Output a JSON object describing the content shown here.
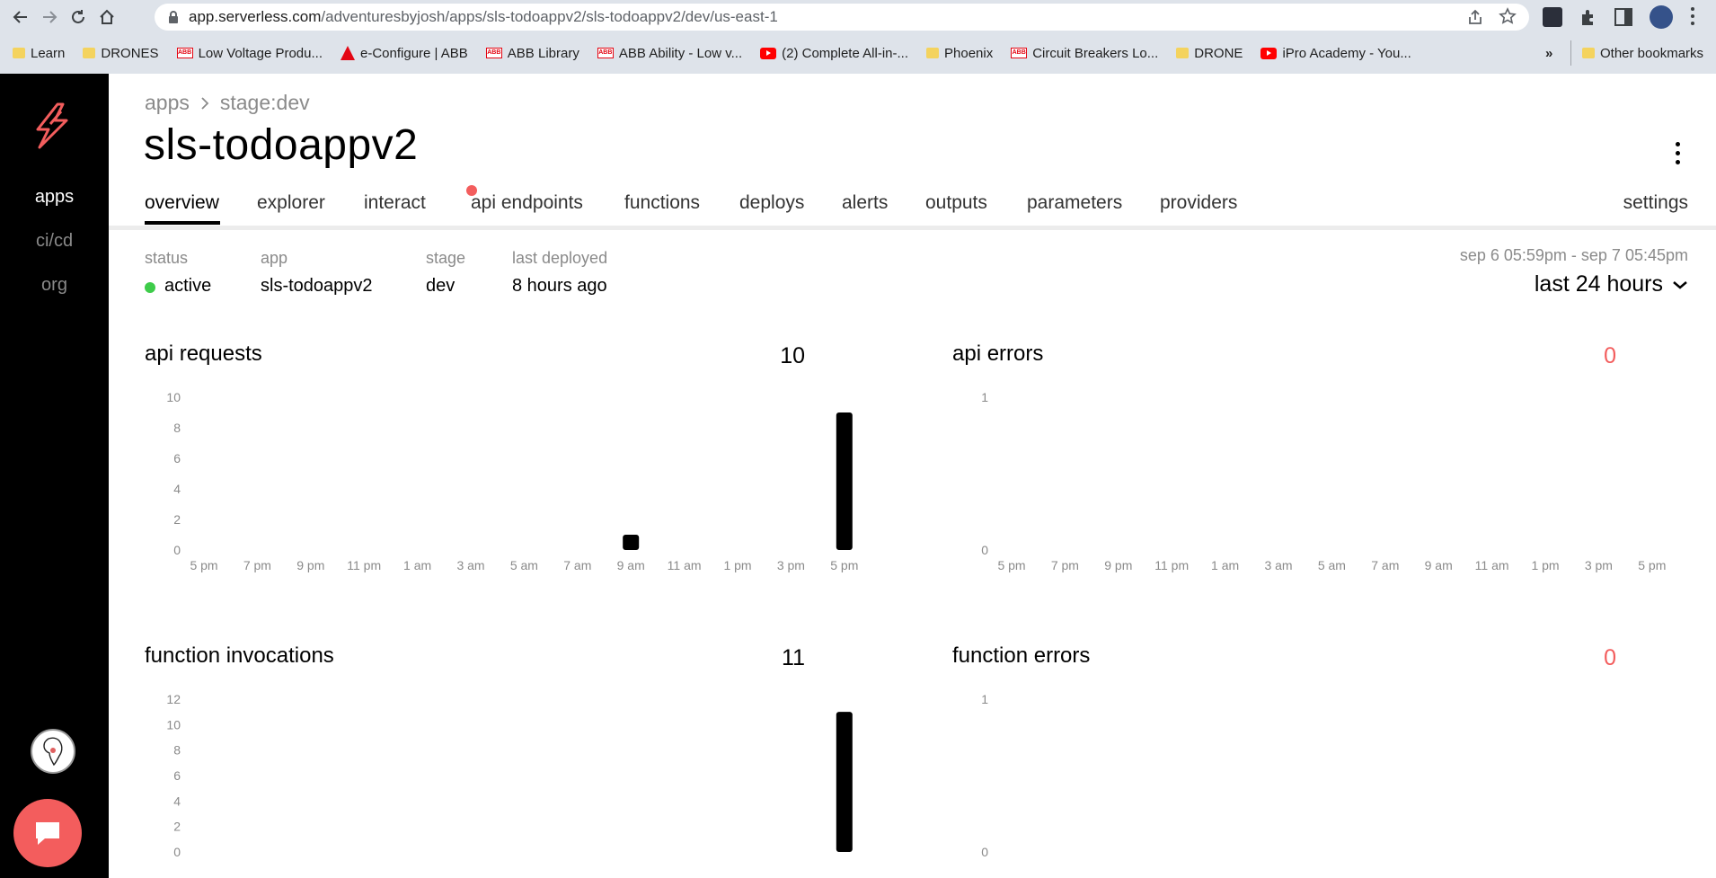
{
  "browser": {
    "url_host": "app.serverless.com",
    "url_path": "/adventuresbyjosh/apps/sls-todoappv2/sls-todoappv2/dev/us-east-1",
    "bookmarks": [
      {
        "label": "Learn",
        "icon": "folder-icon"
      },
      {
        "label": "DRONES",
        "icon": "folder-icon"
      },
      {
        "label": "Low Voltage Produ...",
        "icon": "abb-icon"
      },
      {
        "label": "e-Configure | ABB",
        "icon": "econfigure-icon"
      },
      {
        "label": "ABB Library",
        "icon": "abb-icon"
      },
      {
        "label": "ABB Ability - Low v...",
        "icon": "abb-icon"
      },
      {
        "label": "(2) Complete All-in-...",
        "icon": "youtube-icon"
      },
      {
        "label": "Phoenix",
        "icon": "folder-icon"
      },
      {
        "label": "Circuit Breakers Lo...",
        "icon": "abb-icon"
      },
      {
        "label": "DRONE",
        "icon": "folder-icon"
      },
      {
        "label": "iPro Academy - You...",
        "icon": "youtube-icon"
      }
    ],
    "more_bookmarks": "»",
    "other_bookmarks": "Other bookmarks"
  },
  "sidebar": {
    "items": [
      {
        "label": "apps",
        "active": true
      },
      {
        "label": "ci/cd",
        "active": false
      },
      {
        "label": "org",
        "active": false
      }
    ]
  },
  "breadcrumb": {
    "root": "apps",
    "current": "stage:dev"
  },
  "page_title": "sls-todoappv2",
  "tabs": [
    {
      "label": "overview",
      "active": true
    },
    {
      "label": "explorer"
    },
    {
      "label": "interact",
      "notification": true
    },
    {
      "label": "api endpoints"
    },
    {
      "label": "functions"
    },
    {
      "label": "deploys"
    },
    {
      "label": "alerts"
    },
    {
      "label": "outputs"
    },
    {
      "label": "parameters"
    },
    {
      "label": "providers"
    }
  ],
  "settings_tab": "settings",
  "meta": {
    "status_label": "status",
    "status_value": "active",
    "app_label": "app",
    "app_value": "sls-todoappv2",
    "stage_label": "stage",
    "stage_value": "dev",
    "deployed_label": "last deployed",
    "deployed_value": "8 hours ago"
  },
  "time_range": {
    "span": "sep 6 05:59pm - sep 7 05:45pm",
    "selected": "last 24 hours"
  },
  "colors": {
    "accent": "#f35d5d",
    "status_active": "#3ecc4a",
    "bar": "#000000"
  },
  "chart_data": [
    {
      "type": "bar",
      "title": "api requests",
      "total": "10",
      "x": [
        "5 pm",
        "7 pm",
        "9 pm",
        "11 pm",
        "1 am",
        "3 am",
        "5 am",
        "7 am",
        "9 am",
        "11 am",
        "1 pm",
        "3 pm",
        "5 pm"
      ],
      "yticks": [
        0,
        2,
        4,
        6,
        8,
        10
      ],
      "ylim": [
        0,
        10
      ],
      "bars": [
        {
          "x": "9 am",
          "value": 1
        },
        {
          "x": "5 pm",
          "value": 9
        }
      ]
    },
    {
      "type": "bar",
      "title": "api errors",
      "total": "0",
      "x": [
        "5 pm",
        "7 pm",
        "9 pm",
        "11 pm",
        "1 am",
        "3 am",
        "5 am",
        "7 am",
        "9 am",
        "11 am",
        "1 pm",
        "3 pm",
        "5 pm"
      ],
      "yticks": [
        0,
        1
      ],
      "ylim": [
        0,
        1
      ],
      "bars": []
    },
    {
      "type": "bar",
      "title": "function invocations",
      "total": "11",
      "yticks": [
        0,
        2,
        4,
        6,
        8,
        10,
        12
      ],
      "ylim": [
        0,
        12
      ],
      "bars": [
        {
          "x": "5 pm",
          "value": 11
        }
      ]
    },
    {
      "type": "bar",
      "title": "function errors",
      "total": "0",
      "yticks": [
        0,
        1
      ],
      "ylim": [
        0,
        1
      ],
      "bars": []
    }
  ]
}
